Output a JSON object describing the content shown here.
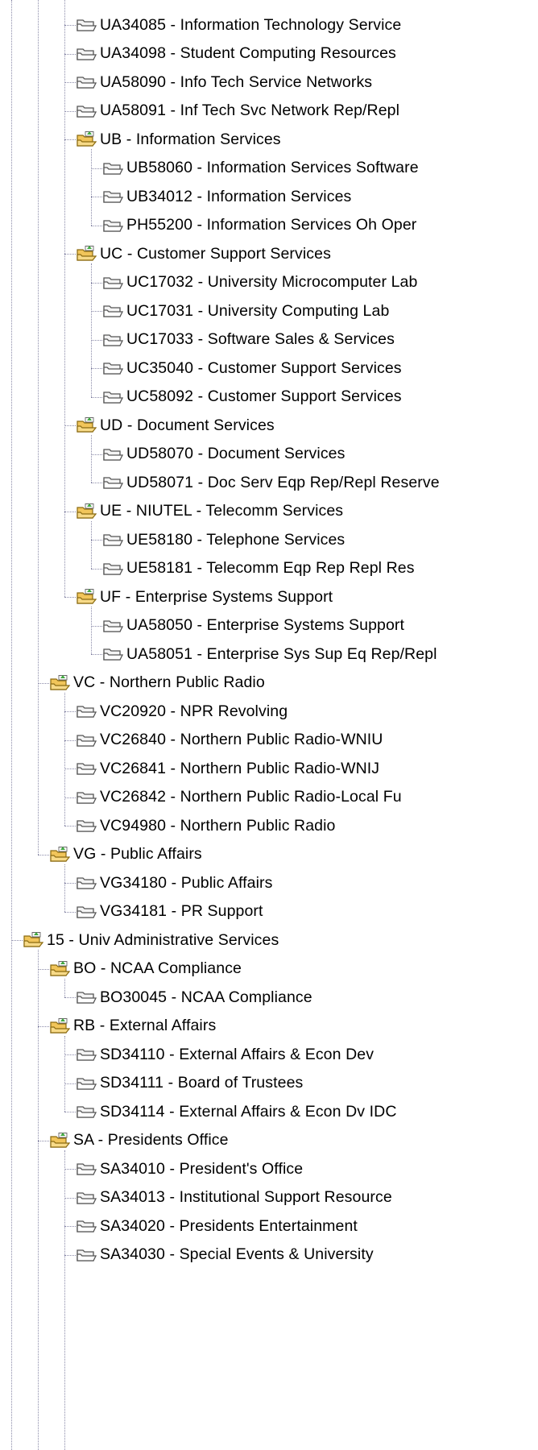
{
  "tree": {
    "nodes": [
      {
        "label": "UA34085 - Information Technology Service",
        "icon": "closed-folder-icon",
        "depth": 2
      },
      {
        "label": "UA34098 - Student Computing Resources",
        "icon": "closed-folder-icon",
        "depth": 2
      },
      {
        "label": "UA58090 - Info Tech Service Networks",
        "icon": "closed-folder-icon",
        "depth": 2
      },
      {
        "label": "UA58091 - Inf Tech Svc Network Rep/Repl",
        "icon": "closed-folder-icon",
        "depth": 2
      },
      {
        "label": "UB - Information Services",
        "icon": "open-folder-icon",
        "depth": 2
      },
      {
        "label": "UB58060 - Information Services Software",
        "icon": "closed-folder-icon",
        "depth": 3
      },
      {
        "label": "UB34012 - Information Services",
        "icon": "closed-folder-icon",
        "depth": 3
      },
      {
        "label": "PH55200 - Information Services Oh Oper",
        "icon": "closed-folder-icon",
        "depth": 3
      },
      {
        "label": "UC - Customer Support Services",
        "icon": "open-folder-icon",
        "depth": 2
      },
      {
        "label": "UC17032 - University Microcomputer Lab",
        "icon": "closed-folder-icon",
        "depth": 3
      },
      {
        "label": "UC17031 - University Computing Lab",
        "icon": "closed-folder-icon",
        "depth": 3
      },
      {
        "label": "UC17033 - Software Sales & Services",
        "icon": "closed-folder-icon",
        "depth": 3
      },
      {
        "label": "UC35040 - Customer Support Services",
        "icon": "closed-folder-icon",
        "depth": 3
      },
      {
        "label": "UC58092 - Customer Support Services",
        "icon": "closed-folder-icon",
        "depth": 3
      },
      {
        "label": "UD - Document Services",
        "icon": "open-folder-icon",
        "depth": 2
      },
      {
        "label": "UD58070 - Document Services",
        "icon": "closed-folder-icon",
        "depth": 3
      },
      {
        "label": "UD58071 - Doc Serv Eqp Rep/Repl Reserve",
        "icon": "closed-folder-icon",
        "depth": 3
      },
      {
        "label": "UE - NIUTEL - Telecomm Services",
        "icon": "open-folder-icon",
        "depth": 2
      },
      {
        "label": "UE58180 - Telephone Services",
        "icon": "closed-folder-icon",
        "depth": 3
      },
      {
        "label": "UE58181 - Telecomm Eqp Rep Repl Res",
        "icon": "closed-folder-icon",
        "depth": 3
      },
      {
        "label": "UF - Enterprise Systems Support",
        "icon": "open-folder-icon",
        "depth": 2
      },
      {
        "label": "UA58050 - Enterprise Systems Support",
        "icon": "closed-folder-icon",
        "depth": 3
      },
      {
        "label": "UA58051 - Enterprise Sys Sup Eq Rep/Repl",
        "icon": "closed-folder-icon",
        "depth": 3
      },
      {
        "label": "VC - Northern Public Radio",
        "icon": "open-folder-icon",
        "depth": 1
      },
      {
        "label": "VC20920 - NPR Revolving",
        "icon": "closed-folder-icon",
        "depth": 2
      },
      {
        "label": "VC26840 - Northern Public Radio-WNIU",
        "icon": "closed-folder-icon",
        "depth": 2
      },
      {
        "label": "VC26841 - Northern Public Radio-WNIJ",
        "icon": "closed-folder-icon",
        "depth": 2
      },
      {
        "label": "VC26842 - Northern Public Radio-Local Fu",
        "icon": "closed-folder-icon",
        "depth": 2
      },
      {
        "label": "VC94980 - Northern Public Radio",
        "icon": "closed-folder-icon",
        "depth": 2
      },
      {
        "label": "VG - Public Affairs",
        "icon": "open-folder-icon",
        "depth": 1
      },
      {
        "label": "VG34180 - Public Affairs",
        "icon": "closed-folder-icon",
        "depth": 2
      },
      {
        "label": "VG34181 - PR Support",
        "icon": "closed-folder-icon",
        "depth": 2
      },
      {
        "label": "15 - Univ Administrative Services",
        "icon": "open-folder-icon",
        "depth": 0
      },
      {
        "label": "BO - NCAA Compliance",
        "icon": "open-folder-icon",
        "depth": 1
      },
      {
        "label": "BO30045 - NCAA Compliance",
        "icon": "closed-folder-icon",
        "depth": 2
      },
      {
        "label": "RB - External Affairs",
        "icon": "open-folder-icon",
        "depth": 1
      },
      {
        "label": "SD34110 - External Affairs & Econ Dev",
        "icon": "closed-folder-icon",
        "depth": 2
      },
      {
        "label": "SD34111 - Board of Trustees",
        "icon": "closed-folder-icon",
        "depth": 2
      },
      {
        "label": "SD34114 - External Affairs & Econ Dv IDC",
        "icon": "closed-folder-icon",
        "depth": 2
      },
      {
        "label": "SA - Presidents Office",
        "icon": "open-folder-icon",
        "depth": 1
      },
      {
        "label": "SA34010 - President's Office",
        "icon": "closed-folder-icon",
        "depth": 2
      },
      {
        "label": "SA34013 - Institutional Support Resource",
        "icon": "closed-folder-icon",
        "depth": 2
      },
      {
        "label": "SA34020 - Presidents Entertainment",
        "icon": "closed-folder-icon",
        "depth": 2
      },
      {
        "label": "SA34030 - Special Events & University",
        "icon": "closed-folder-icon",
        "depth": 2
      }
    ]
  }
}
